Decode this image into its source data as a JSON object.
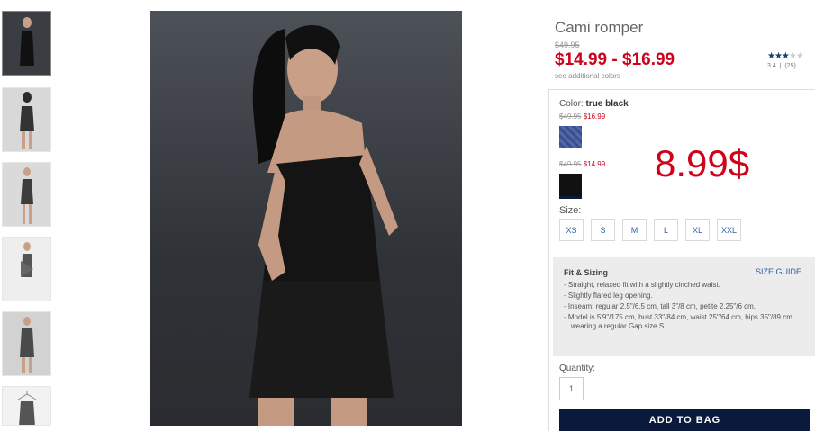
{
  "product": {
    "title": "Cami romper",
    "old_price": "$49.95",
    "price_range": "$14.99 - $16.99",
    "see_colors": "see additional colors",
    "rating": {
      "stars_filled": 3.4,
      "value": "3.4",
      "count": "(25)"
    }
  },
  "color": {
    "label": "Color:",
    "selected": "true black",
    "swatches": [
      {
        "was": "$49.95",
        "now": "$16.99",
        "name": "blue-pattern"
      },
      {
        "was": "$49.95",
        "now": "$14.99",
        "name": "true-black"
      }
    ]
  },
  "overlay_price": "8.99$",
  "size": {
    "label": "Size:",
    "options": [
      "XS",
      "S",
      "M",
      "L",
      "XL",
      "XXL"
    ]
  },
  "fit": {
    "title": "Fit & Sizing",
    "size_guide": "SIZE GUIDE",
    "items": [
      "- Straight, relaxed fit with a slightly cinched waist.",
      "- Slightly flared leg opening.",
      "- Inseam: regular 2.5\"/6.5 cm, tall 3\"/8 cm, petite 2.25\"/6 cm.",
      "- Model is 5'9\"/175 cm, bust 33\"/84 cm, waist 25\"/64 cm, hips 35\"/89 cm wearing a regular Gap size S."
    ]
  },
  "quantity": {
    "label": "Quantity:",
    "value": "1"
  },
  "add_to_bag": "ADD TO BAG",
  "colors": {
    "sale_red": "#d0021b",
    "navy": "#0b1a3c",
    "link_blue": "#2c5da8"
  }
}
